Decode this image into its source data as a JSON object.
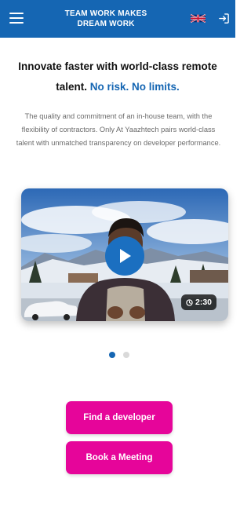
{
  "header": {
    "title": "TEAM WORK MAKES DREAM WORK",
    "menu_icon": "hamburger-menu-icon",
    "language_icon": "uk-flag-icon",
    "login_icon": "login-icon",
    "background_color": "#1566b3"
  },
  "hero": {
    "headline_part1": "Innovate faster with world-class remote talent.",
    "headline_accent": "No risk. No limits.",
    "description": "The quality and commitment of an in-house team, with the flexibility of contractors. Only At Yaazhtech pairs world-class talent with unmatched transparency on developer performance."
  },
  "video": {
    "duration": "2:30",
    "play_icon": "play-icon",
    "clock_icon": "clock-icon"
  },
  "carousel": {
    "page_count": 2,
    "active_index": 0
  },
  "actions": {
    "find_developer": "Find a developer",
    "book_meeting": "Book a Meeting",
    "button_color": "#e6059a"
  }
}
